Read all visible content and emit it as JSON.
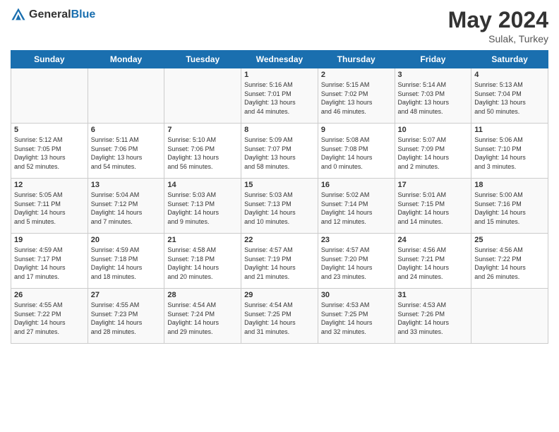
{
  "header": {
    "logo_general": "General",
    "logo_blue": "Blue",
    "title": "May 2024",
    "location": "Sulak, Turkey"
  },
  "weekdays": [
    "Sunday",
    "Monday",
    "Tuesday",
    "Wednesday",
    "Thursday",
    "Friday",
    "Saturday"
  ],
  "weeks": [
    [
      {
        "day": "",
        "info": ""
      },
      {
        "day": "",
        "info": ""
      },
      {
        "day": "",
        "info": ""
      },
      {
        "day": "1",
        "info": "Sunrise: 5:16 AM\nSunset: 7:01 PM\nDaylight: 13 hours\nand 44 minutes."
      },
      {
        "day": "2",
        "info": "Sunrise: 5:15 AM\nSunset: 7:02 PM\nDaylight: 13 hours\nand 46 minutes."
      },
      {
        "day": "3",
        "info": "Sunrise: 5:14 AM\nSunset: 7:03 PM\nDaylight: 13 hours\nand 48 minutes."
      },
      {
        "day": "4",
        "info": "Sunrise: 5:13 AM\nSunset: 7:04 PM\nDaylight: 13 hours\nand 50 minutes."
      }
    ],
    [
      {
        "day": "5",
        "info": "Sunrise: 5:12 AM\nSunset: 7:05 PM\nDaylight: 13 hours\nand 52 minutes."
      },
      {
        "day": "6",
        "info": "Sunrise: 5:11 AM\nSunset: 7:06 PM\nDaylight: 13 hours\nand 54 minutes."
      },
      {
        "day": "7",
        "info": "Sunrise: 5:10 AM\nSunset: 7:06 PM\nDaylight: 13 hours\nand 56 minutes."
      },
      {
        "day": "8",
        "info": "Sunrise: 5:09 AM\nSunset: 7:07 PM\nDaylight: 13 hours\nand 58 minutes."
      },
      {
        "day": "9",
        "info": "Sunrise: 5:08 AM\nSunset: 7:08 PM\nDaylight: 14 hours\nand 0 minutes."
      },
      {
        "day": "10",
        "info": "Sunrise: 5:07 AM\nSunset: 7:09 PM\nDaylight: 14 hours\nand 2 minutes."
      },
      {
        "day": "11",
        "info": "Sunrise: 5:06 AM\nSunset: 7:10 PM\nDaylight: 14 hours\nand 3 minutes."
      }
    ],
    [
      {
        "day": "12",
        "info": "Sunrise: 5:05 AM\nSunset: 7:11 PM\nDaylight: 14 hours\nand 5 minutes."
      },
      {
        "day": "13",
        "info": "Sunrise: 5:04 AM\nSunset: 7:12 PM\nDaylight: 14 hours\nand 7 minutes."
      },
      {
        "day": "14",
        "info": "Sunrise: 5:03 AM\nSunset: 7:13 PM\nDaylight: 14 hours\nand 9 minutes."
      },
      {
        "day": "15",
        "info": "Sunrise: 5:03 AM\nSunset: 7:13 PM\nDaylight: 14 hours\nand 10 minutes."
      },
      {
        "day": "16",
        "info": "Sunrise: 5:02 AM\nSunset: 7:14 PM\nDaylight: 14 hours\nand 12 minutes."
      },
      {
        "day": "17",
        "info": "Sunrise: 5:01 AM\nSunset: 7:15 PM\nDaylight: 14 hours\nand 14 minutes."
      },
      {
        "day": "18",
        "info": "Sunrise: 5:00 AM\nSunset: 7:16 PM\nDaylight: 14 hours\nand 15 minutes."
      }
    ],
    [
      {
        "day": "19",
        "info": "Sunrise: 4:59 AM\nSunset: 7:17 PM\nDaylight: 14 hours\nand 17 minutes."
      },
      {
        "day": "20",
        "info": "Sunrise: 4:59 AM\nSunset: 7:18 PM\nDaylight: 14 hours\nand 18 minutes."
      },
      {
        "day": "21",
        "info": "Sunrise: 4:58 AM\nSunset: 7:18 PM\nDaylight: 14 hours\nand 20 minutes."
      },
      {
        "day": "22",
        "info": "Sunrise: 4:57 AM\nSunset: 7:19 PM\nDaylight: 14 hours\nand 21 minutes."
      },
      {
        "day": "23",
        "info": "Sunrise: 4:57 AM\nSunset: 7:20 PM\nDaylight: 14 hours\nand 23 minutes."
      },
      {
        "day": "24",
        "info": "Sunrise: 4:56 AM\nSunset: 7:21 PM\nDaylight: 14 hours\nand 24 minutes."
      },
      {
        "day": "25",
        "info": "Sunrise: 4:56 AM\nSunset: 7:22 PM\nDaylight: 14 hours\nand 26 minutes."
      }
    ],
    [
      {
        "day": "26",
        "info": "Sunrise: 4:55 AM\nSunset: 7:22 PM\nDaylight: 14 hours\nand 27 minutes."
      },
      {
        "day": "27",
        "info": "Sunrise: 4:55 AM\nSunset: 7:23 PM\nDaylight: 14 hours\nand 28 minutes."
      },
      {
        "day": "28",
        "info": "Sunrise: 4:54 AM\nSunset: 7:24 PM\nDaylight: 14 hours\nand 29 minutes."
      },
      {
        "day": "29",
        "info": "Sunrise: 4:54 AM\nSunset: 7:25 PM\nDaylight: 14 hours\nand 31 minutes."
      },
      {
        "day": "30",
        "info": "Sunrise: 4:53 AM\nSunset: 7:25 PM\nDaylight: 14 hours\nand 32 minutes."
      },
      {
        "day": "31",
        "info": "Sunrise: 4:53 AM\nSunset: 7:26 PM\nDaylight: 14 hours\nand 33 minutes."
      },
      {
        "day": "",
        "info": ""
      }
    ]
  ]
}
